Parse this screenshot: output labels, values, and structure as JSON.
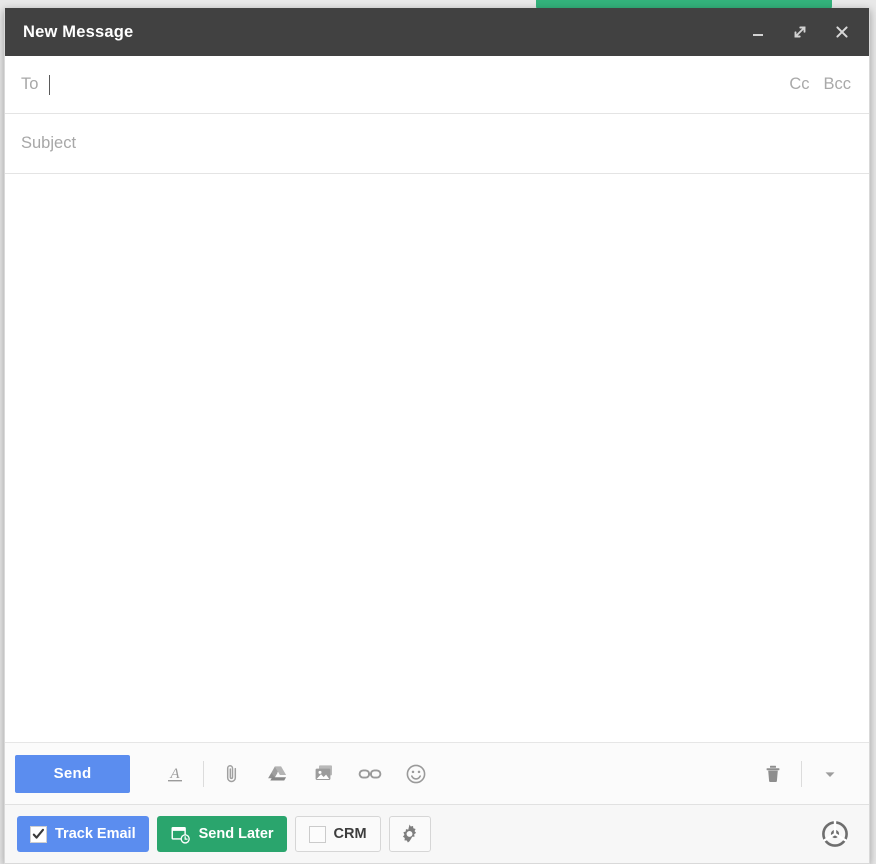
{
  "window": {
    "title": "New Message",
    "titlebar_color": "#414141",
    "controls": [
      {
        "name": "minimize",
        "icon": "minimize-icon"
      },
      {
        "name": "expand",
        "icon": "expand-icon"
      },
      {
        "name": "close",
        "icon": "close-icon"
      }
    ]
  },
  "green_tab": {
    "color": "#33b27b"
  },
  "fields": {
    "to": {
      "label": "To",
      "value": "",
      "placeholder": "To"
    },
    "cc": {
      "label": "Cc"
    },
    "bcc": {
      "label": "Bcc"
    },
    "subject": {
      "label": "Subject",
      "value": "",
      "placeholder": "Subject"
    },
    "body": {
      "value": "",
      "placeholder": ""
    }
  },
  "toolbar": {
    "send_label": "Send",
    "send_color": "#5b8def",
    "icons": [
      {
        "name": "formatting-icon",
        "title": "Formatting options"
      },
      {
        "name": "attach-file-icon",
        "title": "Attach files"
      },
      {
        "name": "google-drive-icon",
        "title": "Insert files using Drive"
      },
      {
        "name": "insert-photo-icon",
        "title": "Insert photo"
      },
      {
        "name": "insert-link-icon",
        "title": "Insert link"
      },
      {
        "name": "insert-emoji-icon",
        "title": "Insert emoji"
      }
    ],
    "discard": {
      "name": "trash-icon",
      "title": "Discard draft"
    },
    "more_options": {
      "name": "more-options-icon",
      "title": "More options"
    }
  },
  "plugin_bar": {
    "track_email": {
      "label": "Track Email",
      "checked": true,
      "color": "#5b8def"
    },
    "send_later": {
      "label": "Send Later",
      "icon": "calendar-clock-icon",
      "color": "#2aa56d"
    },
    "crm": {
      "label": "CRM",
      "checked": false
    },
    "settings": {
      "name": "gear-icon",
      "title": "Settings"
    },
    "brand_logo": {
      "name": "yesware-logo-icon",
      "title": "Yesware"
    }
  }
}
